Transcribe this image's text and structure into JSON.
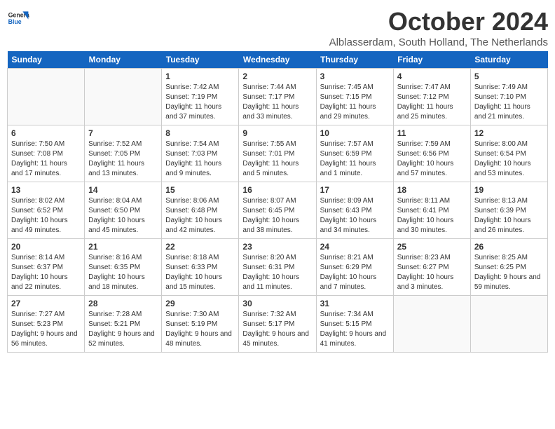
{
  "header": {
    "logo_general": "General",
    "logo_blue": "Blue",
    "month_title": "October 2024",
    "location": "Alblasserdam, South Holland, The Netherlands"
  },
  "weekdays": [
    "Sunday",
    "Monday",
    "Tuesday",
    "Wednesday",
    "Thursday",
    "Friday",
    "Saturday"
  ],
  "weeks": [
    [
      {
        "day": "",
        "info": ""
      },
      {
        "day": "",
        "info": ""
      },
      {
        "day": "1",
        "info": "Sunrise: 7:42 AM\nSunset: 7:19 PM\nDaylight: 11 hours\nand 37 minutes."
      },
      {
        "day": "2",
        "info": "Sunrise: 7:44 AM\nSunset: 7:17 PM\nDaylight: 11 hours\nand 33 minutes."
      },
      {
        "day": "3",
        "info": "Sunrise: 7:45 AM\nSunset: 7:15 PM\nDaylight: 11 hours\nand 29 minutes."
      },
      {
        "day": "4",
        "info": "Sunrise: 7:47 AM\nSunset: 7:12 PM\nDaylight: 11 hours\nand 25 minutes."
      },
      {
        "day": "5",
        "info": "Sunrise: 7:49 AM\nSunset: 7:10 PM\nDaylight: 11 hours\nand 21 minutes."
      }
    ],
    [
      {
        "day": "6",
        "info": "Sunrise: 7:50 AM\nSunset: 7:08 PM\nDaylight: 11 hours\nand 17 minutes."
      },
      {
        "day": "7",
        "info": "Sunrise: 7:52 AM\nSunset: 7:05 PM\nDaylight: 11 hours\nand 13 minutes."
      },
      {
        "day": "8",
        "info": "Sunrise: 7:54 AM\nSunset: 7:03 PM\nDaylight: 11 hours\nand 9 minutes."
      },
      {
        "day": "9",
        "info": "Sunrise: 7:55 AM\nSunset: 7:01 PM\nDaylight: 11 hours\nand 5 minutes."
      },
      {
        "day": "10",
        "info": "Sunrise: 7:57 AM\nSunset: 6:59 PM\nDaylight: 11 hours\nand 1 minute."
      },
      {
        "day": "11",
        "info": "Sunrise: 7:59 AM\nSunset: 6:56 PM\nDaylight: 10 hours\nand 57 minutes."
      },
      {
        "day": "12",
        "info": "Sunrise: 8:00 AM\nSunset: 6:54 PM\nDaylight: 10 hours\nand 53 minutes."
      }
    ],
    [
      {
        "day": "13",
        "info": "Sunrise: 8:02 AM\nSunset: 6:52 PM\nDaylight: 10 hours\nand 49 minutes."
      },
      {
        "day": "14",
        "info": "Sunrise: 8:04 AM\nSunset: 6:50 PM\nDaylight: 10 hours\nand 45 minutes."
      },
      {
        "day": "15",
        "info": "Sunrise: 8:06 AM\nSunset: 6:48 PM\nDaylight: 10 hours\nand 42 minutes."
      },
      {
        "day": "16",
        "info": "Sunrise: 8:07 AM\nSunset: 6:45 PM\nDaylight: 10 hours\nand 38 minutes."
      },
      {
        "day": "17",
        "info": "Sunrise: 8:09 AM\nSunset: 6:43 PM\nDaylight: 10 hours\nand 34 minutes."
      },
      {
        "day": "18",
        "info": "Sunrise: 8:11 AM\nSunset: 6:41 PM\nDaylight: 10 hours\nand 30 minutes."
      },
      {
        "day": "19",
        "info": "Sunrise: 8:13 AM\nSunset: 6:39 PM\nDaylight: 10 hours\nand 26 minutes."
      }
    ],
    [
      {
        "day": "20",
        "info": "Sunrise: 8:14 AM\nSunset: 6:37 PM\nDaylight: 10 hours\nand 22 minutes."
      },
      {
        "day": "21",
        "info": "Sunrise: 8:16 AM\nSunset: 6:35 PM\nDaylight: 10 hours\nand 18 minutes."
      },
      {
        "day": "22",
        "info": "Sunrise: 8:18 AM\nSunset: 6:33 PM\nDaylight: 10 hours\nand 15 minutes."
      },
      {
        "day": "23",
        "info": "Sunrise: 8:20 AM\nSunset: 6:31 PM\nDaylight: 10 hours\nand 11 minutes."
      },
      {
        "day": "24",
        "info": "Sunrise: 8:21 AM\nSunset: 6:29 PM\nDaylight: 10 hours\nand 7 minutes."
      },
      {
        "day": "25",
        "info": "Sunrise: 8:23 AM\nSunset: 6:27 PM\nDaylight: 10 hours\nand 3 minutes."
      },
      {
        "day": "26",
        "info": "Sunrise: 8:25 AM\nSunset: 6:25 PM\nDaylight: 9 hours\nand 59 minutes."
      }
    ],
    [
      {
        "day": "27",
        "info": "Sunrise: 7:27 AM\nSunset: 5:23 PM\nDaylight: 9 hours\nand 56 minutes."
      },
      {
        "day": "28",
        "info": "Sunrise: 7:28 AM\nSunset: 5:21 PM\nDaylight: 9 hours\nand 52 minutes."
      },
      {
        "day": "29",
        "info": "Sunrise: 7:30 AM\nSunset: 5:19 PM\nDaylight: 9 hours\nand 48 minutes."
      },
      {
        "day": "30",
        "info": "Sunrise: 7:32 AM\nSunset: 5:17 PM\nDaylight: 9 hours\nand 45 minutes."
      },
      {
        "day": "31",
        "info": "Sunrise: 7:34 AM\nSunset: 5:15 PM\nDaylight: 9 hours\nand 41 minutes."
      },
      {
        "day": "",
        "info": ""
      },
      {
        "day": "",
        "info": ""
      }
    ]
  ]
}
